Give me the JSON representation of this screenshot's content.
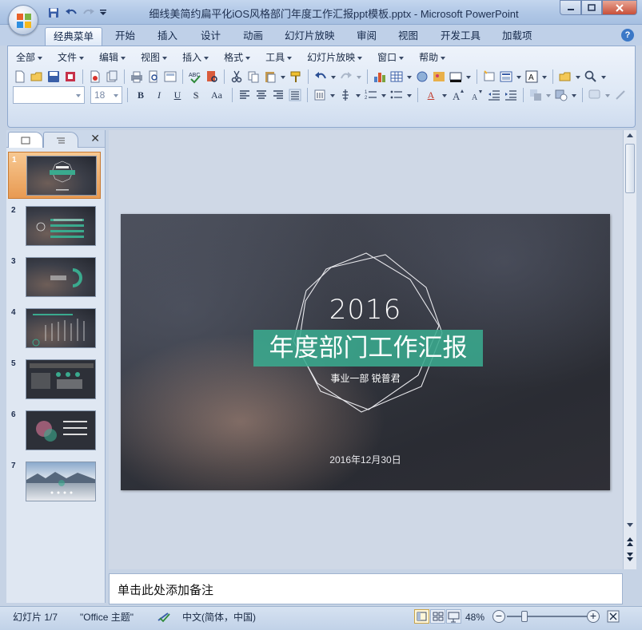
{
  "window": {
    "title": "细线美简约扁平化iOS风格部门年度工作汇报ppt模板.pptx - Microsoft PowerPoint",
    "minimize_icon": "minimize-icon",
    "maximize_icon": "maximize-icon",
    "close_icon": "close-icon"
  },
  "quick_access": [
    "save-icon",
    "undo-icon",
    "redo-icon",
    "customize-icon"
  ],
  "tabs": [
    {
      "label": "经典菜单",
      "active": true
    },
    {
      "label": "开始"
    },
    {
      "label": "插入"
    },
    {
      "label": "设计"
    },
    {
      "label": "动画"
    },
    {
      "label": "幻灯片放映"
    },
    {
      "label": "审阅"
    },
    {
      "label": "视图"
    },
    {
      "label": "开发工具"
    },
    {
      "label": "加载项"
    }
  ],
  "menus": [
    "全部",
    "文件",
    "编辑",
    "视图",
    "插入",
    "格式",
    "工具",
    "幻灯片放映",
    "窗口",
    "帮助"
  ],
  "font": {
    "name": "",
    "size": "18"
  },
  "format_buttons": [
    "B",
    "I",
    "U",
    "S",
    "Aa"
  ],
  "slide_panel": {
    "tab_slides": "slides-tab-icon",
    "tab_outline": "outline-tab-icon",
    "close": "✕",
    "thumbnails": [
      {
        "number": "1",
        "selected": true
      },
      {
        "number": "2"
      },
      {
        "number": "3"
      },
      {
        "number": "4"
      },
      {
        "number": "5"
      },
      {
        "number": "6"
      },
      {
        "number": "7"
      }
    ]
  },
  "slide": {
    "year": "2016",
    "title": "年度部门工作汇报",
    "subtitle": "事业一部 锐普君",
    "date": "2016年12月30日",
    "accent_color": "#3aaa8e"
  },
  "notes": {
    "placeholder": "单击此处添加备注"
  },
  "status": {
    "slide_counter": "幻灯片 1/7",
    "theme": "\"Office 主题\"",
    "language": "中文(简体，中国)",
    "zoom": "48%",
    "zoom_out": "−",
    "zoom_in": "+"
  }
}
